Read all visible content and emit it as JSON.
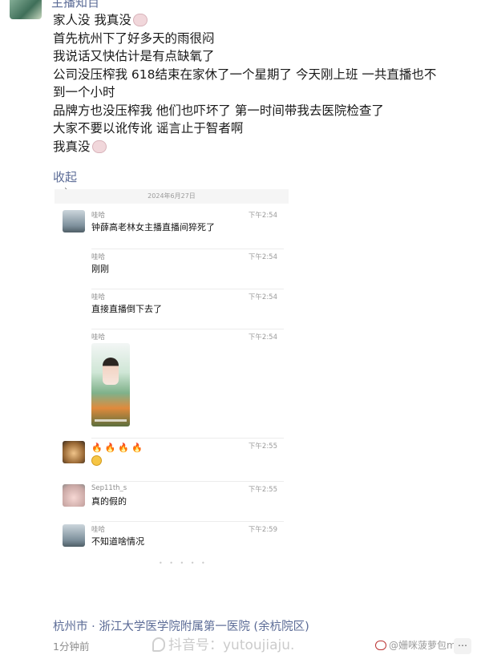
{
  "post": {
    "author": "主播知百",
    "lines": [
      "家人没 我真没",
      "首先杭州下了好多天的雨很闷",
      "我说话又快估计是有点缺氧了",
      "公司没压榨我 618结束在家休了一个星期了  今天刚上班 一共直播也不",
      "到一个小时",
      "品牌方也没压榨我 他们也吓坏了 第一时间带我去医院检查了",
      "大家不要以讹传讹 谣言止于智者啊",
      "我真没"
    ],
    "collapse_label": "收起",
    "location": "杭州市 · 浙江大学医学院附属第一医院 (余杭院区)",
    "time_ago": "1分钟前"
  },
  "chat": {
    "date": "2024年6月27日",
    "messages": [
      {
        "sender": "哇哈",
        "time": "下午2:54",
        "text": "钟薛高老林女主播直播间猝死了",
        "avatar": "bird"
      },
      {
        "sender": "哇哈",
        "time": "下午2:54",
        "text": "刚刚"
      },
      {
        "sender": "哇哈",
        "time": "下午2:54",
        "text": "直接直播倒下去了"
      },
      {
        "sender": "哇哈",
        "time": "下午2:54",
        "text": "",
        "attachment": "video"
      },
      {
        "sender": "",
        "time": "下午2:55",
        "text": "🔥🔥🔥🔥",
        "avatar": "dog",
        "emoji_icon": "astonished-face-icon"
      },
      {
        "sender": "Sep11th_s",
        "time": "下午2:55",
        "text": "真的假的",
        "avatar": "pig"
      },
      {
        "sender": "哇哈",
        "time": "下午2:59",
        "text": "不知道啥情况",
        "avatar": "bird"
      }
    ]
  },
  "watermarks": {
    "douyin": "抖音号：yutoujiaju.",
    "weibo": "@姗咪菠萝包my"
  },
  "colors": {
    "link_blue": "#5b6b96",
    "text": "#1a1a1a",
    "gray": "#8c8c8c"
  }
}
